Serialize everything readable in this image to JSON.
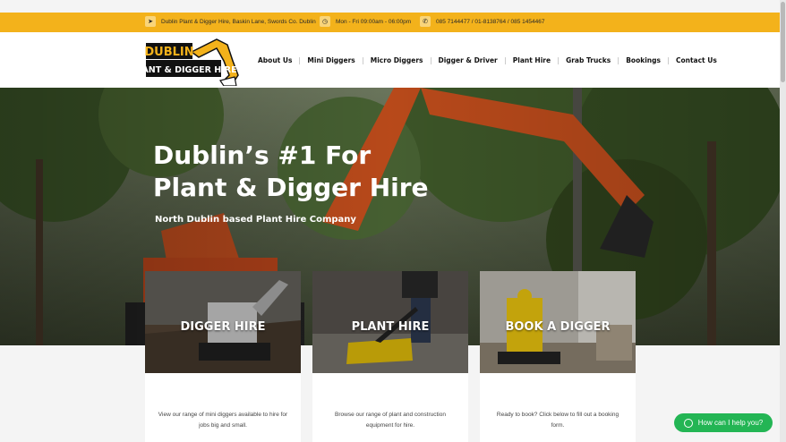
{
  "topbar": {
    "address": "Dublin Plant & Digger Hire, Baskin Lane, Swords Co. Dublin",
    "hours": "Mon - Fri 09:00am - 06:00pm",
    "phones": "085 7144477 / 01-8138764 / 085 1454467"
  },
  "logo": {
    "line1": "DUBLIN",
    "line2": "PLANT & DIGGER HIRE"
  },
  "nav": [
    "About Us",
    "Mini Diggers",
    "Micro Diggers",
    "Digger & Driver",
    "Plant Hire",
    "Grab Trucks",
    "Bookings",
    "Contact Us"
  ],
  "hero": {
    "title": "Dublin’s #1 For Plant & Digger Hire",
    "subtitle": "North Dublin based Plant Hire Company"
  },
  "cards": [
    {
      "title": "DIGGER HIRE",
      "text": "View our range of mini diggers available to hire for jobs big and small."
    },
    {
      "title": "PLANT HIRE",
      "text": "Browse our range of plant and construction equipment for hire."
    },
    {
      "title": "BOOK A DIGGER",
      "text": "Ready to book? Click below to fill out a booking form."
    }
  ],
  "whatsapp": {
    "label": "How can I help you?"
  },
  "colors": {
    "accent": "#f3b21b",
    "whatsapp": "#23b554"
  },
  "icons": {
    "address": "location-arrow-icon",
    "hours": "clock-icon",
    "phone": "phone-icon",
    "whatsapp": "whatsapp-icon"
  }
}
